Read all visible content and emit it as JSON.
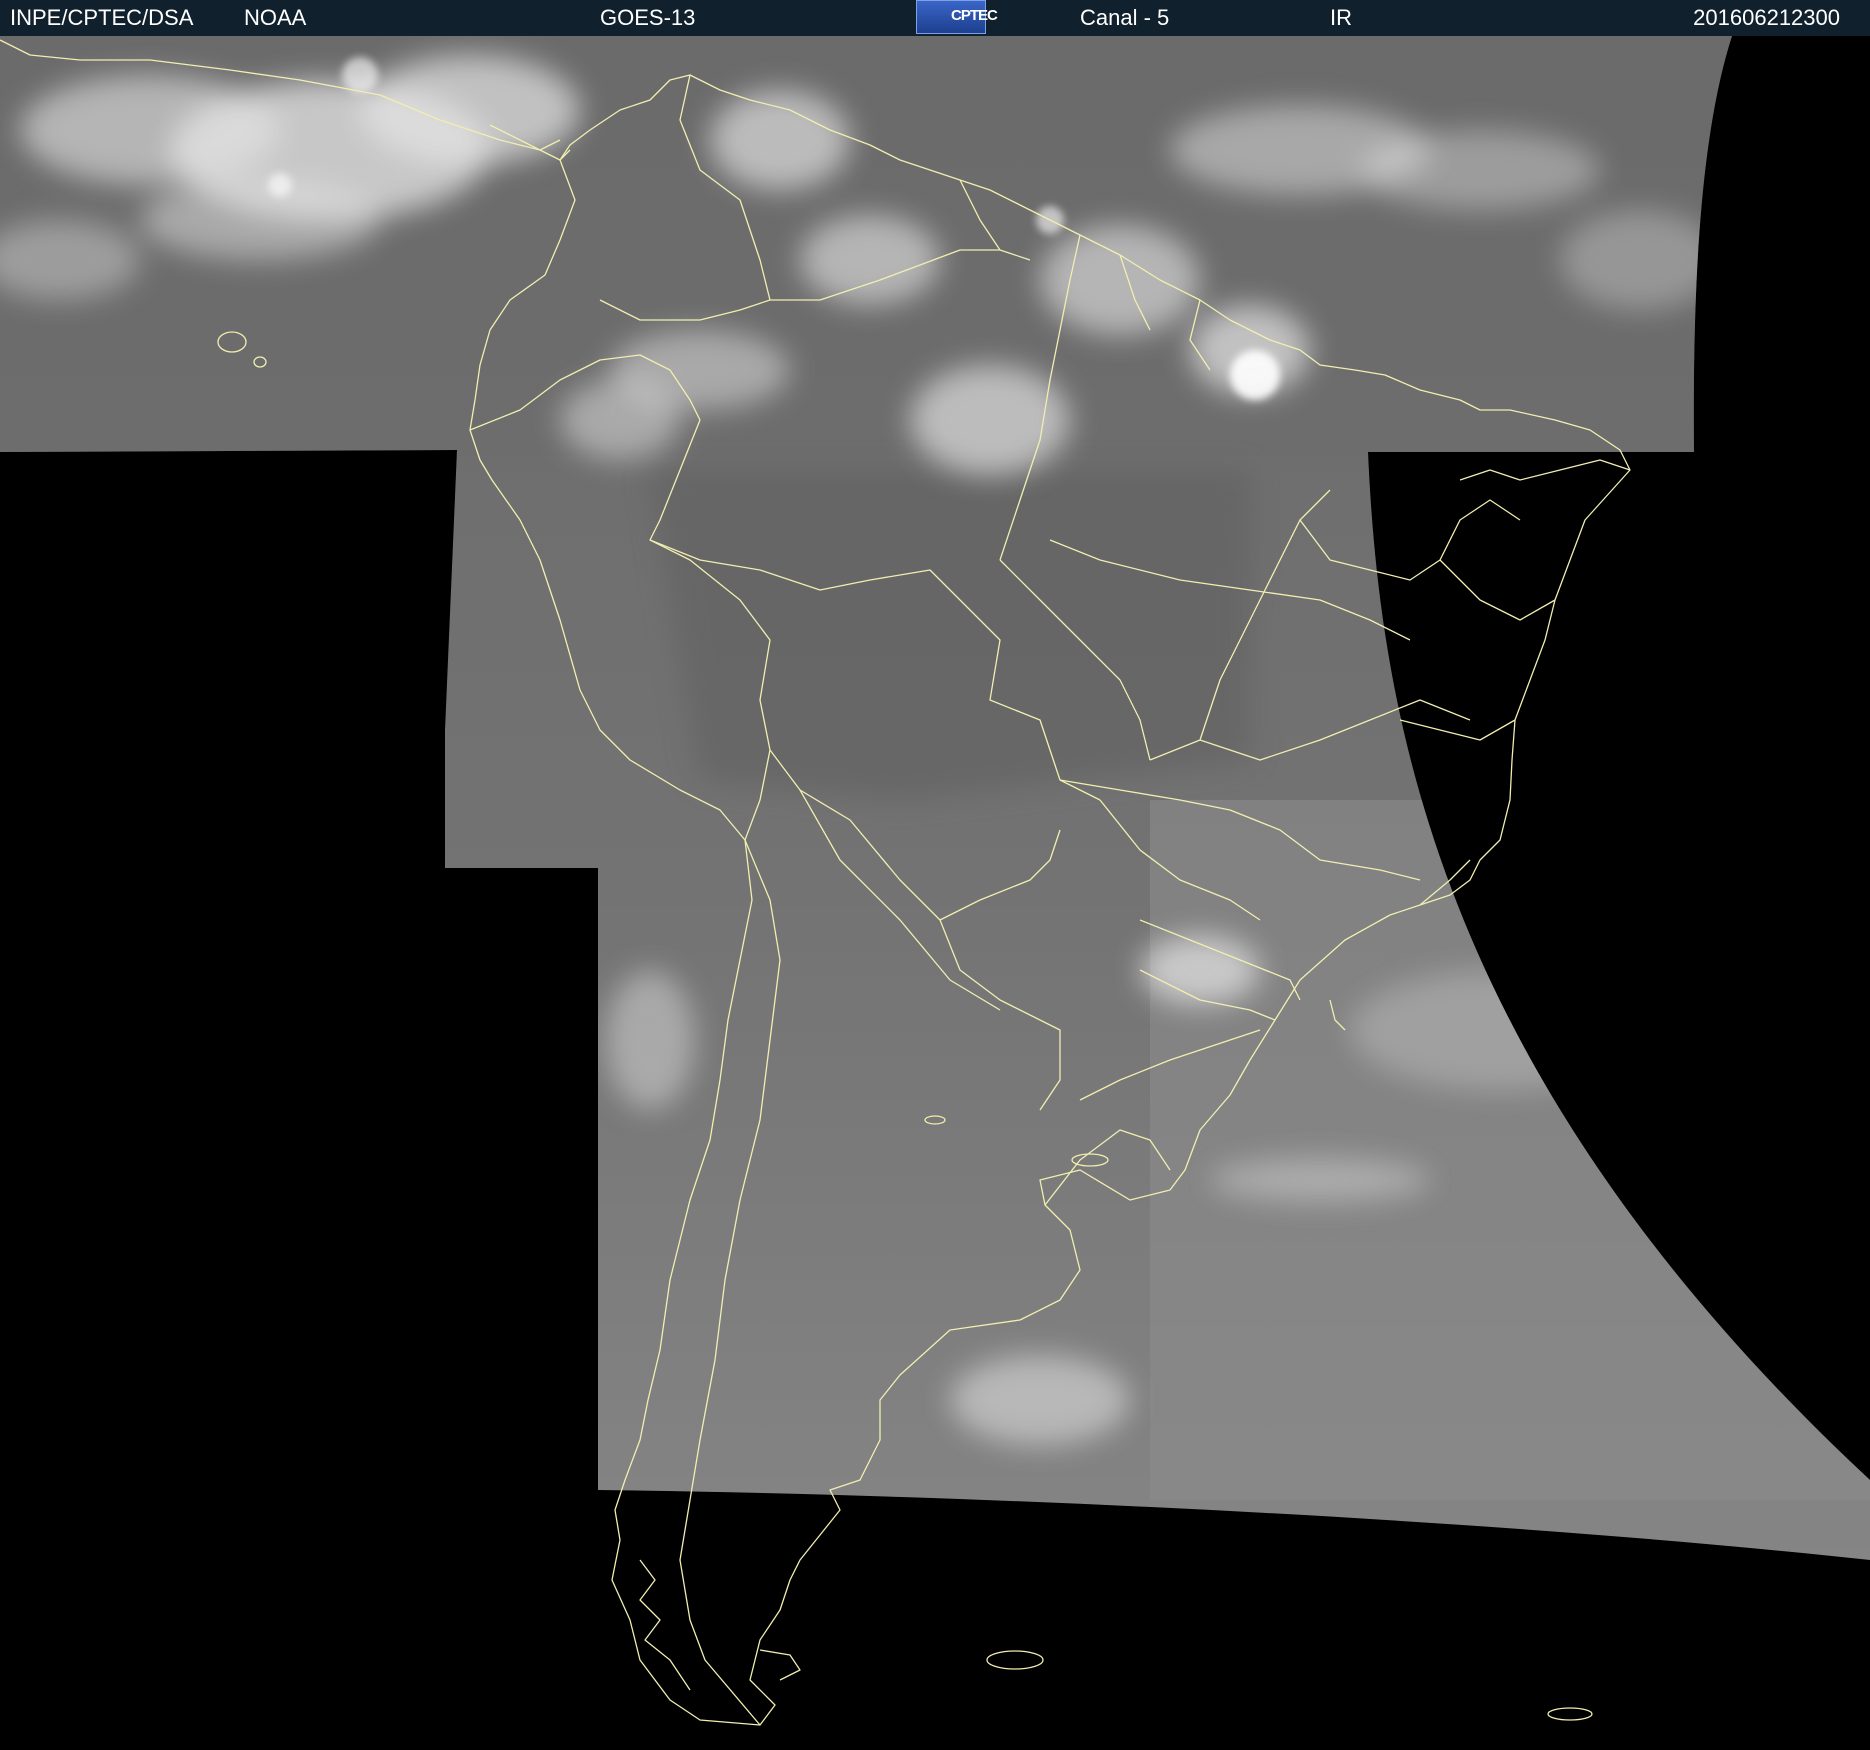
{
  "header": {
    "agency": "INPE/CPTEC/DSA",
    "organization": "NOAA",
    "satellite": "GOES-13",
    "logo_text": "CPTEC",
    "channel": "Canal - 5",
    "band": "IR",
    "timestamp": "201606212300"
  },
  "colors": {
    "header_bg": "#10202c",
    "no_data": "#000000",
    "image_base": "#6e6e6e",
    "borders": "#f0eeb0",
    "clouds": "#e8e8e8"
  },
  "image": {
    "type": "satellite-infrared",
    "region": "South America"
  }
}
